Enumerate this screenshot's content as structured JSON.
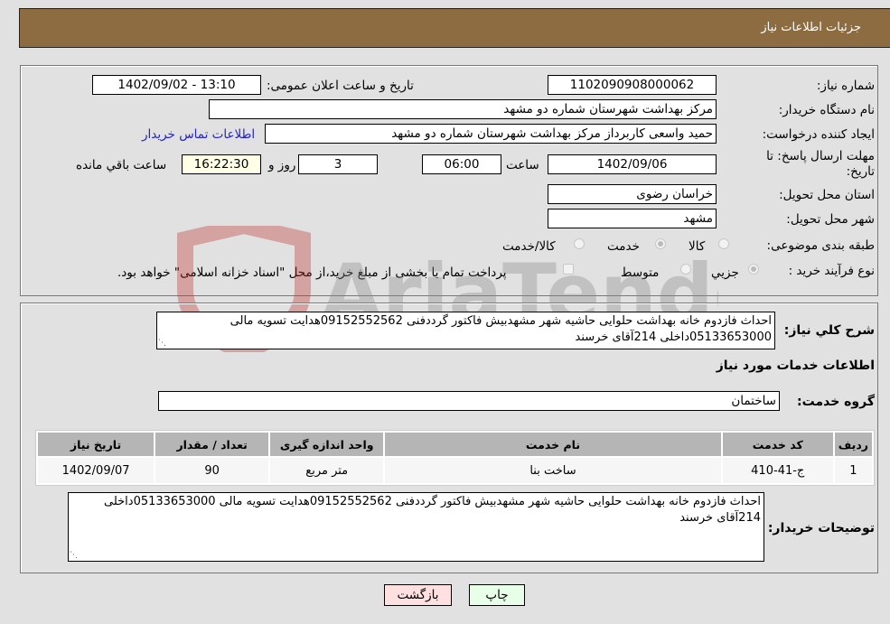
{
  "header": {
    "title": "جزئیات اطلاعات نیاز"
  },
  "fields": {
    "need_number_label": "شماره نیاز:",
    "need_number": "1102090908000062",
    "announce_label": "تاریخ و ساعت اعلان عمومی:",
    "announce_value": "1402/09/02 - 13:10",
    "buyer_org_label": "نام دستگاه خریدار:",
    "buyer_org": "مرکز بهداشت شهرستان شماره دو مشهد",
    "creator_label": "ایجاد کننده درخواست:",
    "creator": "حمید واسعی کاربرداز مرکز بهداشت شهرستان شماره دو مشهد",
    "contact_link": "اطلاعات تماس خریدار",
    "deadline_label_1": "مهلت ارسال پاسخ: تا",
    "deadline_label_2": "تاریخ:",
    "deadline_date": "1402/09/06",
    "time_label": "ساعت",
    "deadline_time": "06:00",
    "days": "3",
    "days_label": "روز و",
    "remaining": "16:22:30",
    "remaining_label": "ساعت باقي مانده",
    "province_label": "استان محل تحویل:",
    "province": "خراسان رضوی",
    "city_label": "شهر محل تحویل:",
    "city": "مشهد",
    "category_label": "طبقه بندی موضوعی:",
    "category_options": [
      "کالا",
      "خدمت",
      "کالا/خدمت"
    ],
    "category_selected": "خدمت",
    "process_label": "نوع فرآیند خرید :",
    "process_options": [
      "جزيي",
      "متوسط"
    ],
    "process_selected": "جزيي",
    "treasury_note": "پرداخت تمام یا بخشی از مبلغ خرید،از محل \"اسناد خزانه اسلامی\" خواهد بود."
  },
  "details": {
    "description_label": "شرح کلي نياز:",
    "description": "احداث فازدوم خانه بهداشت حلوایی حاشیه شهر مشهدبیش فاکتور گرددفنی 09152552562هدایت تسویه مالی 05133653000داخلی 214آقای خرسند",
    "services_heading": "اطلاعات خدمات مورد نیاز",
    "service_group_label": "گروه خدمت:",
    "service_group": "ساختمان",
    "table": {
      "headers": [
        "ردیف",
        "کد خدمت",
        "نام خدمت",
        "واحد اندازه گیری",
        "تعداد / مقدار",
        "تاریخ نیاز"
      ],
      "rows": [
        [
          "1",
          "ج-41-410",
          "ساخت بنا",
          "متر مربع",
          "90",
          "1402/09/07"
        ]
      ]
    },
    "buyer_notes_label": "توضیحات خریدار:",
    "buyer_notes": "احداث فازدوم خانه بهداشت حلوایی حاشیه شهر مشهدبیش فاکتور گرددفنی 09152552562هدایت تسویه مالی 05133653000داخلی 214آقای خرسند"
  },
  "buttons": {
    "print": "چاپ",
    "back": "بازگشت"
  },
  "colors": {
    "header_bg": "#8e6c42",
    "print_bg": "#e8ffe8",
    "back_bg": "#ffe0e0",
    "link": "#2222cc",
    "remaining_bg": "#ffffe8"
  },
  "watermark": "AriaTender.neT"
}
